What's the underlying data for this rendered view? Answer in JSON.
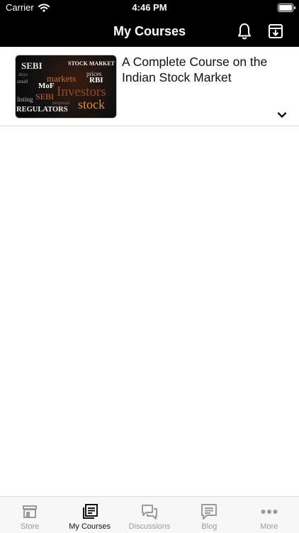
{
  "status_bar": {
    "carrier": "Carrier",
    "time": "4:46 PM",
    "icons": [
      "wifi-icon",
      "battery-icon"
    ]
  },
  "nav": {
    "title": "My Courses",
    "icons": [
      "bell-icon",
      "download-box-icon"
    ]
  },
  "courses": [
    {
      "title": "A Complete Course on the Indian Stock Market",
      "thumbnail_words": [
        "SEBI",
        "STOCK MARKET",
        "days",
        "prices",
        "small",
        "markets",
        "RBI",
        "MoF",
        "Investors",
        "SEBI",
        "listing",
        "proposal",
        "REGULATORS",
        "stock"
      ]
    }
  ],
  "tabs": [
    {
      "label": "Store",
      "icon": "store-icon",
      "active": false
    },
    {
      "label": "My Courses",
      "icon": "courses-icon",
      "active": true
    },
    {
      "label": "Discussions",
      "icon": "discussions-icon",
      "active": false
    },
    {
      "label": "Blog",
      "icon": "blog-icon",
      "active": false
    },
    {
      "label": "More",
      "icon": "more-icon",
      "active": false
    }
  ],
  "colors": {
    "bar_background": "#000000",
    "tab_active": "#111111",
    "tab_inactive": "#9a9a9a"
  }
}
